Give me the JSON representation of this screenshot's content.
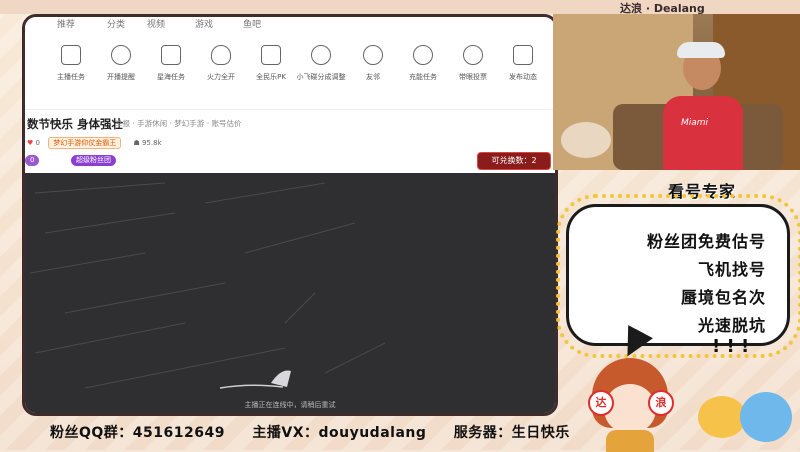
{
  "topbar": {
    "tabs": [
      "推荐",
      "分类",
      "视频",
      "游戏",
      "鱼吧"
    ],
    "corner_text": "达浪 · Dealang"
  },
  "toolbar": {
    "items": [
      {
        "label": "主播任务",
        "icon": "clipboard-icon"
      },
      {
        "label": "开播提醒",
        "icon": "alarm-clock-icon"
      },
      {
        "label": "星海任务",
        "icon": "ad-icon"
      },
      {
        "label": "火力全开",
        "icon": "flame-icon"
      },
      {
        "label": "全民乐PK",
        "icon": "shield-icon"
      },
      {
        "label": "小飞碟分成调整",
        "icon": "ufo-icon"
      },
      {
        "label": "友邻",
        "icon": "people-icon"
      },
      {
        "label": "充能任务",
        "icon": "gauge-icon"
      },
      {
        "label": "带眼投票",
        "icon": "vote-icon"
      },
      {
        "label": "发布动态",
        "icon": "edit-icon"
      }
    ]
  },
  "room": {
    "title": "数节快乐 身体强壮",
    "subtitle": "举报 · 手游休闲 · 梦幻手游 · 账号估价",
    "like_count": "0",
    "badge": "梦幻手游仰仗金霸王",
    "hot": "95.8k",
    "pill1": "0",
    "pill2": "超级粉丝团",
    "exchange_label": "可兑换数：2",
    "video_status": "主播正在连线中，请稍后重试"
  },
  "promo": {
    "heading": "看号专家",
    "lines": [
      "粉丝团免费估号",
      "飞机找号",
      "蜃境包名次",
      "光速脱坑"
    ],
    "exclaim": "! ! !"
  },
  "mascot": {
    "sign_left": "达",
    "sign_right": "浪"
  },
  "cam": {
    "jersey_text": "Miami"
  },
  "footer": {
    "fan_group": "粉丝QQ群：451612649",
    "streamer_vx": "主播VX：douyudalang",
    "server": "服务器：生日快乐"
  }
}
